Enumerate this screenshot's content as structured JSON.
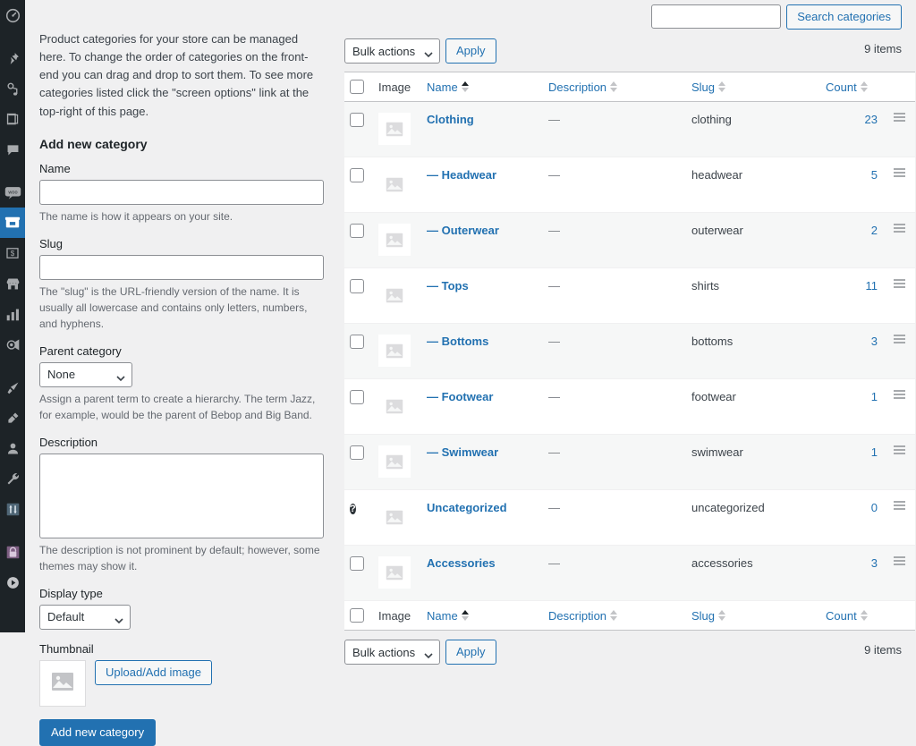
{
  "sidebar": {
    "items": [
      {
        "name": "dashboard",
        "icon": "dashboard-icon",
        "active": false
      },
      {
        "name": "posts",
        "icon": "pin-icon",
        "active": false
      },
      {
        "name": "media",
        "icon": "media-icon",
        "active": false
      },
      {
        "name": "pages",
        "icon": "pages-icon",
        "active": false
      },
      {
        "name": "comments",
        "icon": "comment-icon",
        "active": false
      },
      {
        "name": "woocommerce",
        "icon": "woo-icon",
        "active": false
      },
      {
        "name": "products",
        "icon": "products-icon",
        "active": true
      },
      {
        "name": "payments",
        "icon": "money-icon",
        "active": false
      },
      {
        "name": "store",
        "icon": "store-icon",
        "active": false
      },
      {
        "name": "analytics",
        "icon": "chart-icon",
        "active": false
      },
      {
        "name": "marketing",
        "icon": "megaphone-icon",
        "active": false
      },
      {
        "name": "appearance",
        "icon": "paintbrush-icon",
        "active": false
      },
      {
        "name": "plugins",
        "icon": "plug-icon",
        "active": false
      },
      {
        "name": "users",
        "icon": "user-icon",
        "active": false
      },
      {
        "name": "tools",
        "icon": "wrench-icon",
        "active": false
      },
      {
        "name": "settings",
        "icon": "sliders-icon",
        "active": false
      },
      {
        "name": "security",
        "icon": "lock-icon",
        "active": false
      },
      {
        "name": "player",
        "icon": "play-icon",
        "active": false
      }
    ]
  },
  "form": {
    "intro": "Product categories for your store can be managed here. To change the order of categories on the front-end you can drag and drop to sort them. To see more categories listed click the \"screen options\" link at the top-right of this page.",
    "title": "Add new category",
    "name_label": "Name",
    "name_value": "",
    "name_help": "The name is how it appears on your site.",
    "slug_label": "Slug",
    "slug_value": "",
    "slug_help": "The \"slug\" is the URL-friendly version of the name. It is usually all lowercase and contains only letters, numbers, and hyphens.",
    "parent_label": "Parent category",
    "parent_value": "None",
    "parent_options": [
      "None"
    ],
    "parent_help": "Assign a parent term to create a hierarchy. The term Jazz, for example, would be the parent of Bebop and Big Band.",
    "description_label": "Description",
    "description_value": "",
    "description_help": "The description is not prominent by default; however, some themes may show it.",
    "display_type_label": "Display type",
    "display_type_value": "Default",
    "display_type_options": [
      "Default"
    ],
    "thumbnail_label": "Thumbnail",
    "upload_button": "Upload/Add image",
    "submit_button": "Add new category"
  },
  "search": {
    "value": "",
    "button": "Search categories"
  },
  "toolbar": {
    "bulk_label": "Bulk actions",
    "bulk_options": [
      "Bulk actions"
    ],
    "apply_label": "Apply",
    "items_count": "9 items"
  },
  "table": {
    "columns": {
      "checkbox": "",
      "image": "Image",
      "name": "Name",
      "description": "Description",
      "slug": "Slug",
      "count": "Count"
    },
    "sort": {
      "column": "name",
      "direction": "asc"
    },
    "rows": [
      {
        "name": "Clothing",
        "description": "—",
        "slug": "clothing",
        "count": "23",
        "checkbox": true,
        "boxed_thumb": true
      },
      {
        "name": "— Headwear",
        "description": "—",
        "slug": "headwear",
        "count": "5",
        "checkbox": true,
        "boxed_thumb": false
      },
      {
        "name": "— Outerwear",
        "description": "—",
        "slug": "outerwear",
        "count": "2",
        "checkbox": true,
        "boxed_thumb": true
      },
      {
        "name": "— Tops",
        "description": "—",
        "slug": "shirts",
        "count": "11",
        "checkbox": true,
        "boxed_thumb": false
      },
      {
        "name": "— Bottoms",
        "description": "—",
        "slug": "bottoms",
        "count": "3",
        "checkbox": true,
        "boxed_thumb": true
      },
      {
        "name": "— Footwear",
        "description": "—",
        "slug": "footwear",
        "count": "1",
        "checkbox": true,
        "boxed_thumb": false
      },
      {
        "name": "— Swimwear",
        "description": "—",
        "slug": "swimwear",
        "count": "1",
        "checkbox": true,
        "boxed_thumb": true
      },
      {
        "name": "Uncategorized",
        "description": "—",
        "slug": "uncategorized",
        "count": "0",
        "checkbox": false,
        "boxed_thumb": false,
        "help": "?"
      },
      {
        "name": "Accessories",
        "description": "—",
        "slug": "accessories",
        "count": "3",
        "checkbox": true,
        "boxed_thumb": true
      }
    ]
  },
  "colors": {
    "accent": "#2271b1",
    "sidebar_bg": "#1d2327",
    "page_bg": "#f0f0f1",
    "row_alt": "#f6f7f7"
  }
}
